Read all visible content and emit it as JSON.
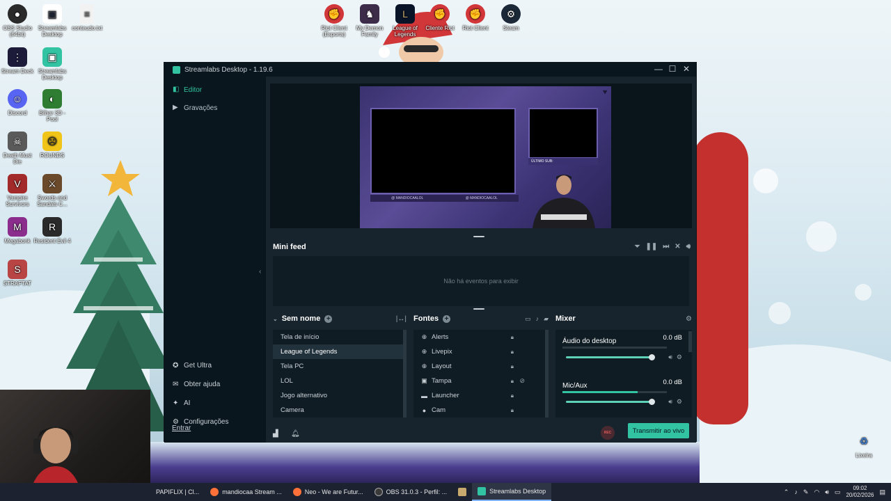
{
  "desktop": {
    "icons": [
      {
        "label": "OBS Studio (64bit)",
        "color": "#2a2a2a",
        "glyph": "●"
      },
      {
        "label": "Streamlabs Desktop",
        "color": "#31c3a2",
        "glyph": "▣"
      },
      {
        "label": "Stream Deck",
        "color": "#1d1b3a",
        "glyph": "⋮⋮"
      },
      {
        "label": "Discord",
        "color": "#5865f2",
        "glyph": "☺"
      },
      {
        "label": "Death Must Die",
        "color": "#5a5a5a",
        "glyph": "☠"
      },
      {
        "label": "Vampire Survivors",
        "color": "#a32a2a",
        "glyph": "V"
      },
      {
        "label": "Megabonk",
        "color": "#8a2d8d",
        "glyph": "M"
      },
      {
        "label": "STRAFTAT",
        "color": "#b84444",
        "glyph": "S"
      },
      {
        "label": "Streamlabs Desktop",
        "color": "#31c3a2",
        "glyph": "▣"
      },
      {
        "label": "Bilhar 3D - Pool",
        "color": "#2e7d32",
        "glyph": "◐"
      },
      {
        "label": "ROUNDS",
        "color": "#f0c419",
        "glyph": "☹"
      },
      {
        "label": "Swords and Sandals C...",
        "color": "#6b4a2b",
        "glyph": "⚔"
      },
      {
        "label": "Resident Evil 4",
        "color": "#2a2a2a",
        "glyph": "R"
      },
      {
        "label": "conteudo.txt",
        "color": "#e9e9e9",
        "glyph": "≡"
      },
      {
        "label": "Riot Client (Esports)",
        "color": "#d13639",
        "glyph": "✊"
      },
      {
        "label": "My Demon Family",
        "color": "#3d2b4a",
        "glyph": "♞"
      },
      {
        "label": "League of Legends",
        "color": "#c8aa6e",
        "glyph": "L"
      },
      {
        "label": "Cliente Riot",
        "color": "#d13639",
        "glyph": "✊"
      },
      {
        "label": "Riot Client",
        "color": "#d13639",
        "glyph": "✊"
      },
      {
        "label": "Steam",
        "color": "#1b2838",
        "glyph": "⚙"
      },
      {
        "label": "Lixeira",
        "color": "#cfe3ee",
        "glyph": "♻"
      }
    ]
  },
  "window": {
    "title": "Streamlabs Desktop - 1.19.6",
    "minimize": "—",
    "maximize": "☐",
    "close": "✕"
  },
  "sidebar": {
    "top_items": [
      {
        "label": "Editor",
        "icon": "◧"
      },
      {
        "label": "Gravações",
        "icon": "▶"
      }
    ],
    "bottom_items": [
      {
        "label": "Get Ultra",
        "icon": "✪"
      },
      {
        "label": "Obter ajuda",
        "icon": "✉"
      },
      {
        "label": "AI",
        "icon": "✦"
      },
      {
        "label": "Configurações",
        "icon": "⚙"
      }
    ],
    "login": "Entrar"
  },
  "preview": {
    "social_left": "@ MANDIOCAALOL",
    "social_right": "@ MANDIOCAALOL",
    "last_sub": "ÚLTIMO SUB:"
  },
  "minifeed": {
    "title": "Mini feed",
    "empty": "Não há eventos para exibir"
  },
  "scenes": {
    "title": "Sem nome",
    "items": [
      "Tela de início",
      "League of Legends",
      "Tela PC",
      "LOL",
      "Jogo alternativo",
      "Camera"
    ],
    "selected": "League of Legends"
  },
  "sources": {
    "title": "Fontes",
    "items": [
      {
        "label": "Alerts",
        "icon": "⊕"
      },
      {
        "label": "Livepix",
        "icon": "⊕"
      },
      {
        "label": "Layout",
        "icon": "⊕"
      },
      {
        "label": "Tampa",
        "icon": "▣"
      },
      {
        "label": "Launcher",
        "icon": "▬"
      },
      {
        "label": "Cam",
        "icon": "●"
      }
    ]
  },
  "mixer": {
    "title": "Mixer",
    "channels": [
      {
        "name": "Áudio do desktop",
        "db": "0.0 dB",
        "meter_level": 0.0
      },
      {
        "name": "Mic/Aux",
        "db": "0.0 dB",
        "meter_level": 0.72
      }
    ]
  },
  "footer": {
    "rec": "REC",
    "go_live": "Transmitir ao vivo"
  },
  "taskbar": {
    "items": [
      {
        "label": "PAPIFLIX | Cl...",
        "color": "#e24b2b"
      },
      {
        "label": "mandiocaa Stream ...",
        "color": "#ff7139"
      },
      {
        "label": "Neo - We are Futur...",
        "color": "#ff7139"
      },
      {
        "label": "OBS 31.0.3 - Perfil: ...",
        "color": "#3a3a3a"
      },
      {
        "label": "",
        "color": "#c8aa6e"
      },
      {
        "label": "Streamlabs Desktop",
        "color": "#31c3a2"
      }
    ],
    "time": "09:02",
    "date": "20/02/2026"
  }
}
